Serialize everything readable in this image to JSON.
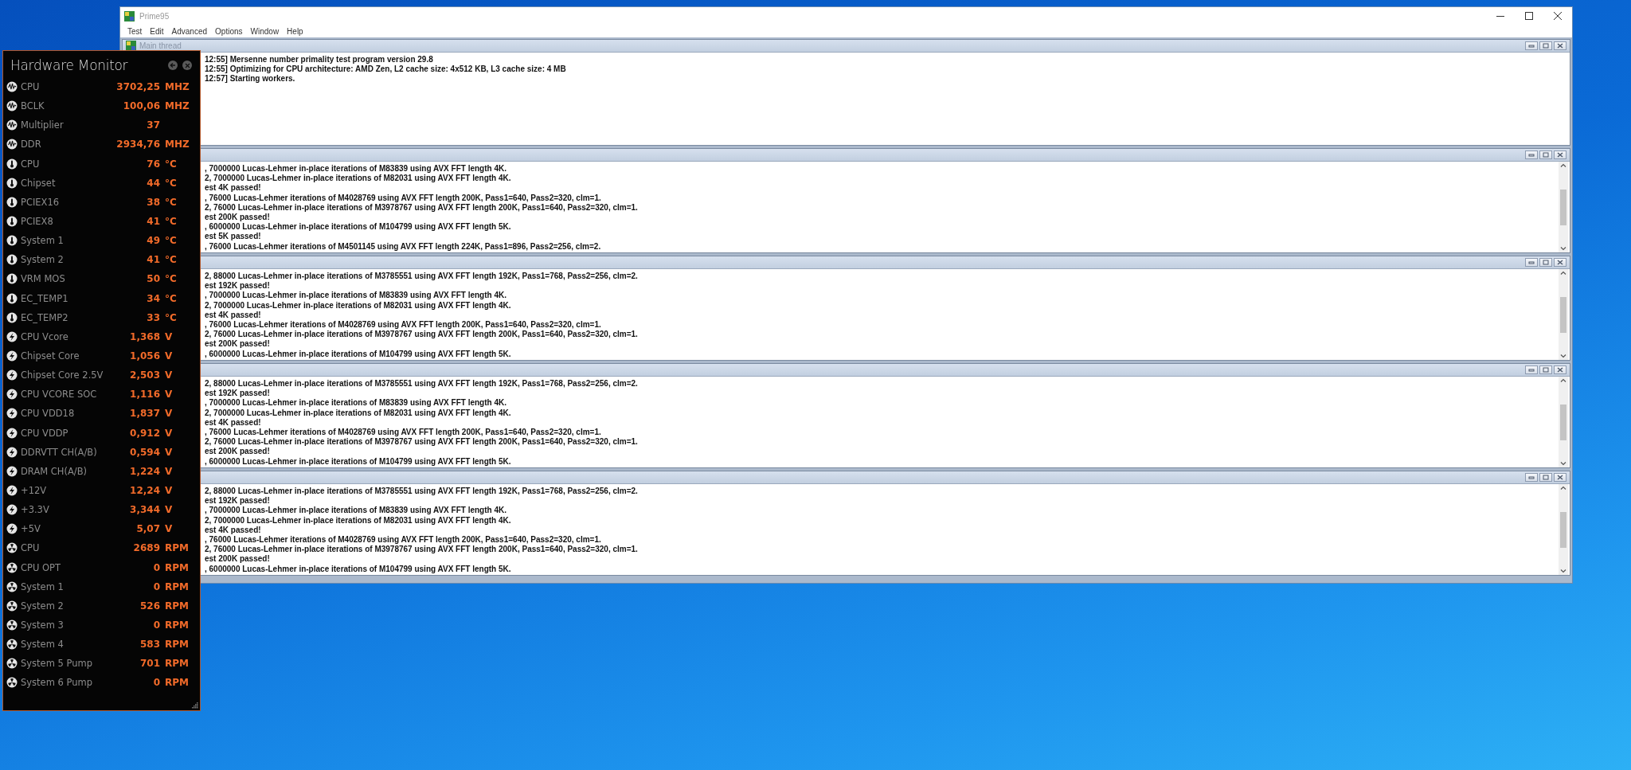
{
  "prime95": {
    "title": "Prime95",
    "menu": [
      "Test",
      "Edit",
      "Advanced",
      "Options",
      "Window",
      "Help"
    ],
    "threads": [
      {
        "title": "Main thread",
        "scrollable": false,
        "lines": [
          "12:55] Mersenne number primality test program version 29.8",
          "12:55] Optimizing for CPU architecture: AMD Zen, L2 cache size: 4x512 KB, L3 cache size: 4 MB",
          "12:57] Starting workers."
        ]
      },
      {
        "scrollable": true,
        "lines": [
          ", 7000000 Lucas-Lehmer in-place iterations of M83839 using AVX FFT length 4K.",
          "2, 7000000 Lucas-Lehmer in-place iterations of M82031 using AVX FFT length 4K.",
          "est 4K passed!",
          ", 76000 Lucas-Lehmer iterations of M4028769 using AVX FFT length 200K, Pass1=640, Pass2=320, clm=1.",
          "2, 76000 Lucas-Lehmer in-place iterations of M3978767 using AVX FFT length 200K, Pass1=640, Pass2=320, clm=1.",
          "est 200K passed!",
          ", 6000000 Lucas-Lehmer in-place iterations of M104799 using AVX FFT length 5K.",
          "est 5K passed!",
          ", 76000 Lucas-Lehmer iterations of M4501145 using AVX FFT length 224K, Pass1=896, Pass2=256, clm=2."
        ]
      },
      {
        "scrollable": true,
        "lines": [
          "2, 88000 Lucas-Lehmer in-place iterations of M3785551 using AVX FFT length 192K, Pass1=768, Pass2=256, clm=2.",
          "est 192K passed!",
          ", 7000000 Lucas-Lehmer in-place iterations of M83839 using AVX FFT length 4K.",
          "2, 7000000 Lucas-Lehmer in-place iterations of M82031 using AVX FFT length 4K.",
          "est 4K passed!",
          ", 76000 Lucas-Lehmer iterations of M4028769 using AVX FFT length 200K, Pass1=640, Pass2=320, clm=1.",
          "2, 76000 Lucas-Lehmer in-place iterations of M3978767 using AVX FFT length 200K, Pass1=640, Pass2=320, clm=1.",
          "est 200K passed!",
          ", 6000000 Lucas-Lehmer in-place iterations of M104799 using AVX FFT length 5K."
        ]
      },
      {
        "scrollable": true,
        "lines": [
          "2, 88000 Lucas-Lehmer in-place iterations of M3785551 using AVX FFT length 192K, Pass1=768, Pass2=256, clm=2.",
          "est 192K passed!",
          ", 7000000 Lucas-Lehmer in-place iterations of M83839 using AVX FFT length 4K.",
          "2, 7000000 Lucas-Lehmer in-place iterations of M82031 using AVX FFT length 4K.",
          "est 4K passed!",
          ", 76000 Lucas-Lehmer iterations of M4028769 using AVX FFT length 200K, Pass1=640, Pass2=320, clm=1.",
          "2, 76000 Lucas-Lehmer in-place iterations of M3978767 using AVX FFT length 200K, Pass1=640, Pass2=320, clm=1.",
          "est 200K passed!",
          ", 6000000 Lucas-Lehmer in-place iterations of M104799 using AVX FFT length 5K."
        ]
      },
      {
        "scrollable": true,
        "lines": [
          "2, 88000 Lucas-Lehmer in-place iterations of M3785551 using AVX FFT length 192K, Pass1=768, Pass2=256, clm=2.",
          "est 192K passed!",
          ", 7000000 Lucas-Lehmer in-place iterations of M83839 using AVX FFT length 4K.",
          "2, 7000000 Lucas-Lehmer in-place iterations of M82031 using AVX FFT length 4K.",
          "est 4K passed!",
          ", 76000 Lucas-Lehmer iterations of M4028769 using AVX FFT length 200K, Pass1=640, Pass2=320, clm=1.",
          "2, 76000 Lucas-Lehmer in-place iterations of M3978767 using AVX FFT length 200K, Pass1=640, Pass2=320, clm=1.",
          "est 200K passed!",
          ", 6000000 Lucas-Lehmer in-place iterations of M104799 using AVX FFT length 5K."
        ]
      }
    ]
  },
  "hardware_monitor": {
    "title": "Hardware Monitor",
    "rows": [
      {
        "kind": "clock",
        "label": "CPU",
        "value": "3702,25",
        "unit": "MHZ"
      },
      {
        "kind": "clock",
        "label": "BCLK",
        "value": "100,06",
        "unit": "MHZ"
      },
      {
        "kind": "clock",
        "label": "Multiplier",
        "value": "37"
      },
      {
        "kind": "clock",
        "label": "DDR",
        "value": "2934,76",
        "unit": "MHZ"
      },
      {
        "kind": "temperature",
        "label": "CPU",
        "value": "76",
        "unit": "°C"
      },
      {
        "kind": "temperature",
        "label": "Chipset",
        "value": "44",
        "unit": "°C"
      },
      {
        "kind": "temperature",
        "label": "PCIEX16",
        "value": "38",
        "unit": "°C"
      },
      {
        "kind": "temperature",
        "label": "PCIEX8",
        "value": "41",
        "unit": "°C"
      },
      {
        "kind": "temperature",
        "label": "System 1",
        "value": "49",
        "unit": "°C"
      },
      {
        "kind": "temperature",
        "label": "System 2",
        "value": "41",
        "unit": "°C"
      },
      {
        "kind": "temperature",
        "label": "VRM MOS",
        "value": "50",
        "unit": "°C"
      },
      {
        "kind": "temperature",
        "label": "EC_TEMP1",
        "value": "34",
        "unit": "°C"
      },
      {
        "kind": "temperature",
        "label": "EC_TEMP2",
        "value": "33",
        "unit": "°C"
      },
      {
        "kind": "voltage",
        "label": "CPU Vcore",
        "value": "1,368",
        "unit": "V"
      },
      {
        "kind": "voltage",
        "label": "Chipset Core",
        "value": "1,056",
        "unit": "V"
      },
      {
        "kind": "voltage",
        "label": "Chipset Core 2.5V",
        "value": "2,503",
        "unit": "V"
      },
      {
        "kind": "voltage",
        "label": "CPU VCORE SOC",
        "value": "1,116",
        "unit": "V"
      },
      {
        "kind": "voltage",
        "label": "CPU VDD18",
        "value": "1,837",
        "unit": "V"
      },
      {
        "kind": "voltage",
        "label": "CPU VDDP",
        "value": "0,912",
        "unit": "V"
      },
      {
        "kind": "voltage",
        "label": "DDRVTT CH(A/B)",
        "value": "0,594",
        "unit": "V"
      },
      {
        "kind": "voltage",
        "label": "DRAM CH(A/B)",
        "value": "1,224",
        "unit": "V"
      },
      {
        "kind": "voltage",
        "label": "+12V",
        "value": "12,24",
        "unit": "V"
      },
      {
        "kind": "voltage",
        "label": "+3.3V",
        "value": "3,344",
        "unit": "V"
      },
      {
        "kind": "voltage",
        "label": "+5V",
        "value": "5,07",
        "unit": "V"
      },
      {
        "kind": "fan",
        "label": "CPU",
        "value": "2689",
        "unit": "RPM"
      },
      {
        "kind": "fan",
        "label": "CPU OPT",
        "value": "0",
        "unit": "RPM"
      },
      {
        "kind": "fan",
        "label": "System 1",
        "value": "0",
        "unit": "RPM"
      },
      {
        "kind": "fan",
        "label": "System 2",
        "value": "526",
        "unit": "RPM"
      },
      {
        "kind": "fan",
        "label": "System 3",
        "value": "0",
        "unit": "RPM"
      },
      {
        "kind": "fan",
        "label": "System 4",
        "value": "583",
        "unit": "RPM"
      },
      {
        "kind": "fan",
        "label": "System 5 Pump",
        "value": "701",
        "unit": "RPM"
      },
      {
        "kind": "fan",
        "label": "System 6 Pump",
        "value": "0",
        "unit": "RPM"
      }
    ]
  }
}
